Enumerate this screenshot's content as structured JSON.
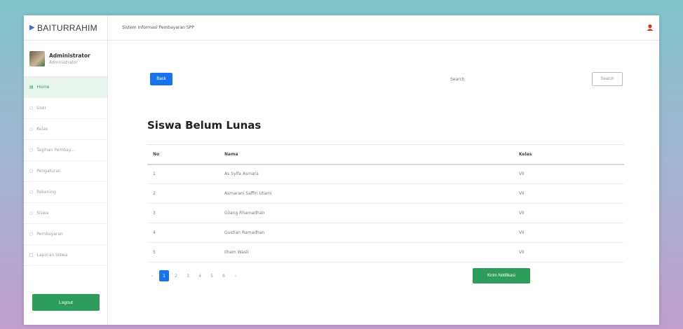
{
  "brand": {
    "name": "BAITURRAHIM",
    "icon": "play-icon"
  },
  "user": {
    "name": "Administrator",
    "role": "Administrator"
  },
  "sidebar": {
    "items": [
      {
        "label": "Home",
        "icon": "home-icon",
        "active": true
      },
      {
        "label": "User",
        "icon": "user-icon",
        "active": false
      },
      {
        "label": "Kelas",
        "icon": "class-icon",
        "active": false
      },
      {
        "label": "Tagihan Pembay...",
        "icon": "bill-icon",
        "active": false
      },
      {
        "label": "Pengaturan",
        "icon": "settings-icon",
        "active": false
      },
      {
        "label": "Rekening",
        "icon": "account-icon",
        "active": false
      },
      {
        "label": "Siswa",
        "icon": "student-icon",
        "active": false
      },
      {
        "label": "Pembayaran",
        "icon": "payment-icon",
        "active": false
      },
      {
        "label": "Laporan Siswa",
        "icon": "report-icon",
        "active": false
      }
    ],
    "logout_label": "Logout"
  },
  "topbar": {
    "title": "Sistem Informasi Pembayaran SPP"
  },
  "toolbar": {
    "back_label": "Back",
    "search_placeholder": "Search",
    "search_button_label": "Search"
  },
  "page_title": "Siswa Belum Lunas",
  "table": {
    "headers": [
      "No",
      "Nama",
      "Kelas"
    ],
    "rows": [
      [
        "1",
        "As Syifa Asmara",
        "VII"
      ],
      [
        "2",
        "Asmarani Saffiri Utami",
        "VII"
      ],
      [
        "3",
        "Gilang Rhamadhan",
        "VII"
      ],
      [
        "4",
        "Gustian Ramadhan",
        "VII"
      ],
      [
        "5",
        "Ilham Wasli",
        "VII"
      ]
    ]
  },
  "pagination": {
    "prev": "‹",
    "pages": [
      "1",
      "2",
      "3",
      "4",
      "5",
      "6"
    ],
    "next": "›",
    "current": "1"
  },
  "notify_button_label": "Kirim Notifikasi",
  "colors": {
    "primary": "#1a73e8",
    "success": "#2e9d5c",
    "active_menu_bg": "#e8f5ec"
  }
}
